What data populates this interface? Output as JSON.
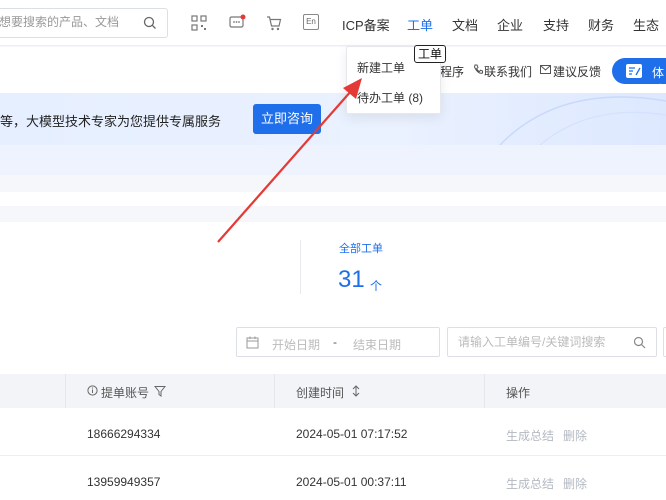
{
  "topnav": {
    "search_placeholder": "想要搜索的产品、文档",
    "links": [
      "ICP备案",
      "工单",
      "文档",
      "企业",
      "支持",
      "财务",
      "生态"
    ],
    "active_link": "工单",
    "lang_badge": "En"
  },
  "dropdown": {
    "items": [
      "新建工单",
      "待办工单 (8)"
    ],
    "tooltip": "工单"
  },
  "subnav": {
    "links": [
      "程序",
      "联系我们",
      "建议反馈"
    ],
    "trial_label": "体验"
  },
  "banner": {
    "text": "等，大模型技术专家为您提供专属服务",
    "button_label": "立即咨询"
  },
  "stats": {
    "label": "全部工单",
    "value": "31",
    "unit": "个"
  },
  "filters": {
    "start_date_placeholder": "开始日期",
    "end_date_placeholder": "结束日期",
    "separator": "-",
    "search_placeholder": "请输入工单编号/关键词搜索"
  },
  "table": {
    "headers": {
      "account": "提单账号",
      "created": "创建时间",
      "actions": "操作"
    },
    "rows": [
      {
        "account": "18666294334",
        "created": "2024-05-01 07:17:52",
        "summary": "生成总结",
        "delete": "删除"
      },
      {
        "account": "13959949357",
        "created": "2024-05-01 00:37:11",
        "summary": "生成总结",
        "delete": "删除"
      }
    ]
  },
  "colors": {
    "accent": "#1f6feb",
    "arrow": "#e53935"
  }
}
